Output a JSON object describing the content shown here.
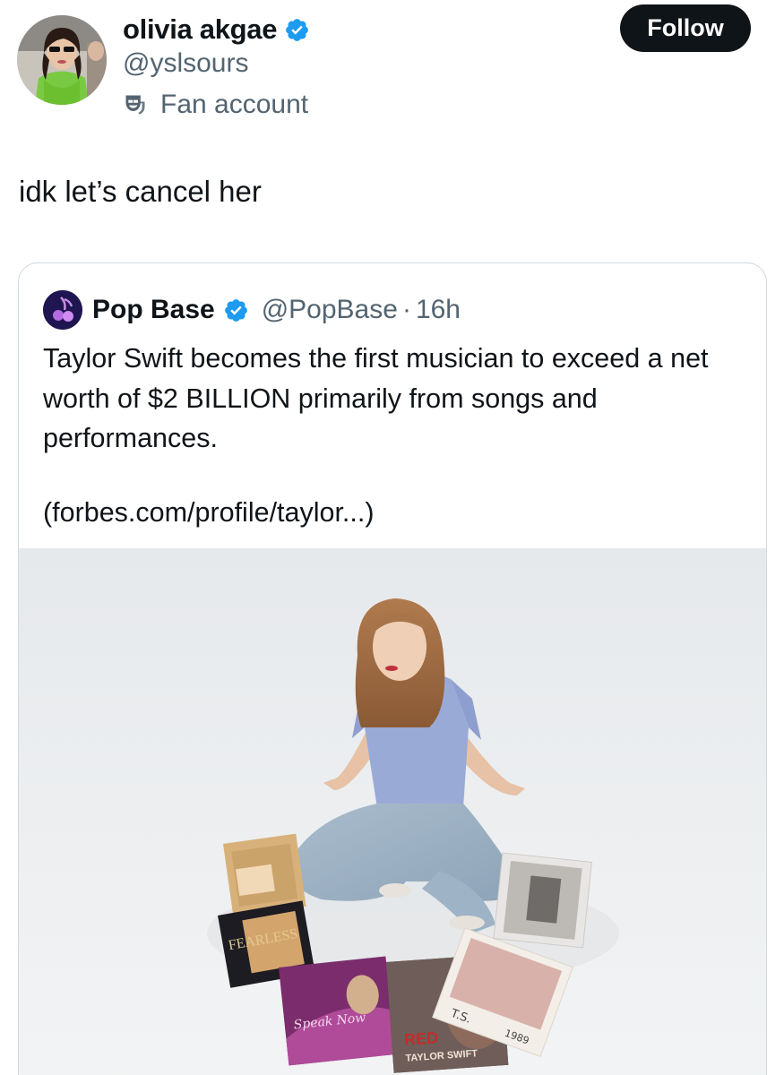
{
  "author": {
    "display_name": "olivia akgae",
    "handle": "@yslsours",
    "label": "Fan account",
    "verified": true
  },
  "actions": {
    "follow_label": "Follow"
  },
  "post": {
    "text": "idk let’s cancel her"
  },
  "quoted_post": {
    "display_name": "Pop Base",
    "handle": "@PopBase",
    "separator": "·",
    "time": "16h",
    "verified": true,
    "text": "Taylor Swift becomes the first musician to exceed a net worth of $2 BILLION primarily from songs and performances.",
    "link_text": "(forbes.com/profile/taylor...)",
    "media": {
      "alt_icons": [
        "photo"
      ],
      "album_labels": [
        "RED",
        "TAYLOR SWIFT",
        "T.S.",
        "1989",
        "Speak Now",
        "FEARLESS"
      ]
    }
  },
  "colors": {
    "verified_blue": "#1d9bf0",
    "text_primary": "#0f1419",
    "text_secondary": "#536471",
    "follow_bg": "#0f1419",
    "border": "#cfd9de"
  }
}
